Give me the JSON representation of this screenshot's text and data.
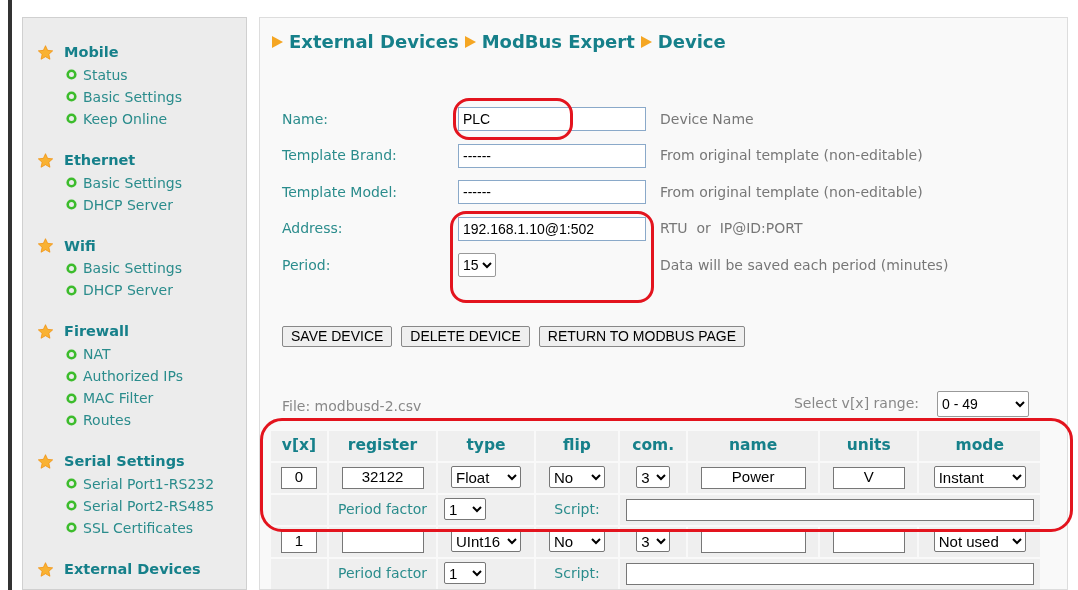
{
  "sidebar": {
    "sections": [
      {
        "title": "Mobile",
        "items": [
          {
            "label": "Status"
          },
          {
            "label": "Basic Settings"
          },
          {
            "label": "Keep Online"
          }
        ]
      },
      {
        "title": "Ethernet",
        "items": [
          {
            "label": "Basic Settings"
          },
          {
            "label": "DHCP Server"
          }
        ]
      },
      {
        "title": "Wifi",
        "items": [
          {
            "label": "Basic Settings"
          },
          {
            "label": "DHCP Server"
          }
        ]
      },
      {
        "title": "Firewall",
        "items": [
          {
            "label": "NAT"
          },
          {
            "label": "Authorized IPs"
          },
          {
            "label": "MAC Filter"
          },
          {
            "label": "Routes"
          }
        ]
      },
      {
        "title": "Serial Settings",
        "items": [
          {
            "label": "Serial Port1-RS232"
          },
          {
            "label": "Serial Port2-RS485"
          },
          {
            "label": "SSL Certificates"
          }
        ]
      },
      {
        "title": "External Devices"
      }
    ]
  },
  "breadcrumb": [
    "External Devices",
    "ModBus Expert",
    "Device"
  ],
  "form": {
    "fields": [
      {
        "label": "Name:",
        "kind": "text",
        "value": "PLC",
        "hint": "Device Name"
      },
      {
        "label": "Template Brand:",
        "kind": "text",
        "value": "------",
        "hint": "From original template (non-editable)"
      },
      {
        "label": "Template Model:",
        "kind": "text",
        "value": "------",
        "hint": "From original template (non-editable)"
      },
      {
        "label": "Address:",
        "kind": "text",
        "value": "192.168.1.10@1:502",
        "hint": "RTU  or  IP@ID:PORT"
      },
      {
        "label": "Period:",
        "kind": "select",
        "value": "15",
        "hint": "Data will be saved each period (minutes)"
      }
    ]
  },
  "buttons": [
    "SAVE DEVICE",
    "DELETE DEVICE",
    "RETURN TO MODBUS PAGE"
  ],
  "file_label": "File: modbusd-2.csv",
  "range": {
    "label": "Select v[x] range:",
    "value": "0 - 49"
  },
  "table": {
    "columns": [
      "v[x]",
      "register",
      "type",
      "flip",
      "com.",
      "name",
      "units",
      "mode"
    ],
    "rows": [
      {
        "vx": "0",
        "register": "32122",
        "type": "Float",
        "flip": "No",
        "com": "3",
        "name": "Power",
        "units": "V",
        "mode": "Instant",
        "period_factor_label": "Period factor",
        "period_factor": "1",
        "script_label": "Script:"
      },
      {
        "vx": "1",
        "type": "UInt16",
        "flip": "No",
        "com": "3",
        "mode": "Not used",
        "period_factor_label": "Period factor",
        "period_factor": "1",
        "script_label": "Script:"
      }
    ]
  },
  "highlights": [
    {
      "kind": "oval"
    },
    {
      "kind": "oval"
    },
    {
      "kind": "oval"
    }
  ]
}
